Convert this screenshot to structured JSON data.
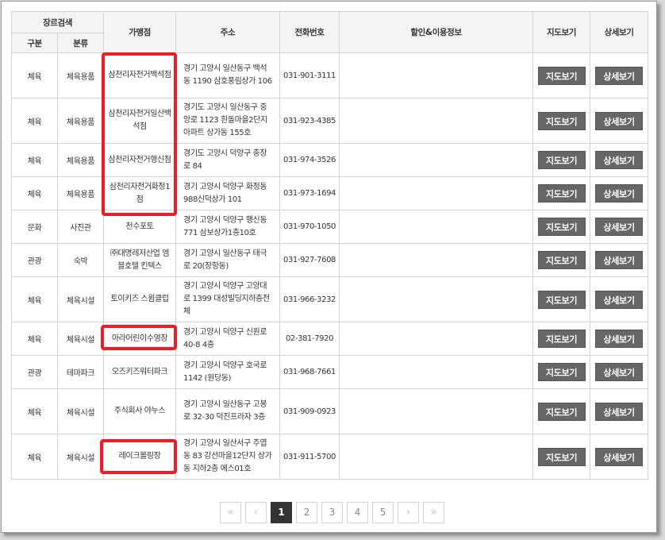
{
  "table": {
    "headers": {
      "genre": "장르검색",
      "category": "구분",
      "subcategory": "분류",
      "store": "가맹점",
      "address": "주소",
      "phone": "전화번호",
      "discount": "할인&이용정보",
      "map": "지도보기",
      "detail": "상세보기"
    },
    "rows": [
      {
        "category": "체육",
        "subcategory": "체육용품",
        "store": "삼천리자전거백석점",
        "address": "경기 고양시 일산동구 백석동 1190 삼호풍림상가 106",
        "phone": "031-901-3111",
        "discount": "",
        "map_btn": "지도보기",
        "detail_btn": "상세보기"
      },
      {
        "category": "체육",
        "subcategory": "체육용품",
        "store": "삼천리자전거일산백석점",
        "address": "경기도 고양시 일산동구 중앙로 1123 흰돌마을2단지아파트 상가동 155호",
        "phone": "031-923-4385",
        "discount": "",
        "map_btn": "지도보기",
        "detail_btn": "상세보기"
      },
      {
        "category": "체육",
        "subcategory": "체육용품",
        "store": "삼천리자전거행신점",
        "address": "경기도 고양시 덕양구 충장로 84",
        "phone": "031-974-3526",
        "discount": "",
        "map_btn": "지도보기",
        "detail_btn": "상세보기"
      },
      {
        "category": "체육",
        "subcategory": "체육용품",
        "store": "삼천리자전거화정1점",
        "address": "경기 고양시 덕양구 화정동 988신덕상가 101",
        "phone": "031-973-1694",
        "discount": "",
        "map_btn": "지도보기",
        "detail_btn": "상세보기"
      },
      {
        "category": "문화",
        "subcategory": "사진관",
        "store": "천수포토",
        "address": "경기 고양시 덕양구 행신동 771 삼보상가1층10호",
        "phone": "031-970-1050",
        "discount": "",
        "map_btn": "지도보기",
        "detail_btn": "상세보기"
      },
      {
        "category": "관광",
        "subcategory": "숙박",
        "store": "㈜대명레저산업 엠블호텔 킨텍스",
        "address": "경기 고양시 일산동구 태극로 20(장항동)",
        "phone": "031-927-7608",
        "discount": "",
        "map_btn": "지도보기",
        "detail_btn": "상세보기"
      },
      {
        "category": "체육",
        "subcategory": "체육시설",
        "store": "토이키즈 스윔클럽",
        "address": "경기 고양시 덕양구 고양대로 1399 대성빌딩지하층전체",
        "phone": "031-966-3232",
        "discount": "",
        "map_btn": "지도보기",
        "detail_btn": "상세보기"
      },
      {
        "category": "체육",
        "subcategory": "체육시설",
        "store": "아라어린이수영장",
        "address": "경기 고양시 덕양구 신원로 40-8 4층",
        "phone": "02-381-7920",
        "discount": "",
        "map_btn": "지도보기",
        "detail_btn": "상세보기"
      },
      {
        "category": "관광",
        "subcategory": "테마파크",
        "store": "오즈키즈워터파크",
        "address": "경기 고양시 덕양구 호국로 1142 (원당동)",
        "phone": "031-968-7661",
        "discount": "",
        "map_btn": "지도보기",
        "detail_btn": "상세보기"
      },
      {
        "category": "체육",
        "subcategory": "체육시설",
        "store": "주식회사 야누스",
        "address": "경기 고양시 일산동구 고봉로 32-30 덕진프라자 3층",
        "phone": "031-909-0923",
        "discount": "",
        "map_btn": "지도보기",
        "detail_btn": "상세보기"
      },
      {
        "category": "체육",
        "subcategory": "체육시설",
        "store": "레이크볼링장",
        "address": "경기 고양시 일산서구 주엽동 83 강선마을12단지 상가동 지하2층 에스01호",
        "phone": "031-911-5700",
        "discount": "",
        "map_btn": "지도보기",
        "detail_btn": "상세보기"
      }
    ]
  },
  "pagination": {
    "first": "«",
    "prev": "‹",
    "pages": [
      "1",
      "2",
      "3",
      "4",
      "5"
    ],
    "current": "1",
    "next": "›",
    "last": "»"
  },
  "highlight_color": "#ee1c24",
  "button_color": "#666666"
}
